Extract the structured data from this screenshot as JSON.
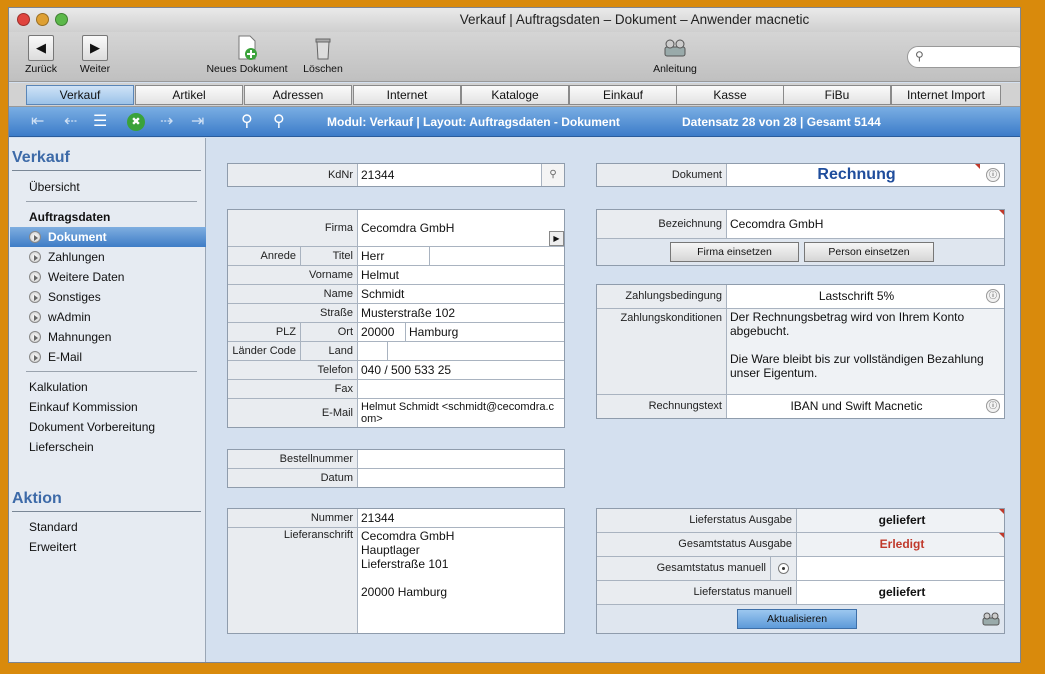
{
  "window": {
    "title": "Verkauf | Auftragsdaten – Dokument – Anwender macnetic"
  },
  "toolbar": {
    "back": "Zurück",
    "forward": "Weiter",
    "new_document": "Neues Dokument",
    "delete": "Löschen",
    "guide": "Anleitung",
    "search_placeholder": ""
  },
  "tabs": [
    "Verkauf",
    "Artikel",
    "Adressen",
    "Internet",
    "Kataloge",
    "Einkauf",
    "Kasse",
    "FiBu",
    "Internet Import"
  ],
  "navbar": {
    "modul": "Modul: Verkauf | Layout: Auftragsdaten - Dokument",
    "datensatz": "Datensatz 28 von 28 | Gesamt 5144"
  },
  "sidebar": {
    "section1": "Verkauf",
    "overview": "Übersicht",
    "auftragsdaten": "Auftragsdaten",
    "items": [
      "Dokument",
      "Zahlungen",
      "Weitere Daten",
      "Sonstiges",
      "wAdmin",
      "Mahnungen",
      "E-Mail"
    ],
    "items2": [
      "Kalkulation",
      "Einkauf Kommission",
      "Dokument Vorbereitung",
      "Lieferschein"
    ],
    "section2": "Aktion",
    "actions": [
      "Standard",
      "Erweitert"
    ]
  },
  "customer": {
    "kdnr_label": "KdNr",
    "kdnr": "21344"
  },
  "address": {
    "firma_label": "Firma",
    "firma": "Cecomdra GmbH",
    "anrede_label": "Anrede",
    "titel_label": "Titel",
    "titel": "Herr",
    "vorname_label": "Vorname",
    "vorname": "Helmut",
    "name_label": "Name",
    "name": "Schmidt",
    "strasse_label": "Straße",
    "strasse": "Musterstraße 102",
    "plz_label": "PLZ",
    "ort_label": "Ort",
    "plz": "20000",
    "ort": "Hamburg",
    "laendercode_label": "Länder Code",
    "land_label": "Land",
    "telefon_label": "Telefon",
    "telefon": "040 / 500 533 25",
    "fax_label": "Fax",
    "email_label": "E-Mail",
    "email": "Helmut Schmidt <schmidt@cecomdra.com>"
  },
  "order": {
    "bestell_label": "Bestellnummer",
    "datum_label": "Datum"
  },
  "delivery": {
    "nummer_label": "Nummer",
    "nummer": "21344",
    "anschrift_label": "Lieferanschrift",
    "anschrift": [
      "Cecomdra GmbH",
      "Hauptlager",
      "Lieferstraße 101",
      "",
      "20000 Hamburg"
    ]
  },
  "document": {
    "label": "Dokument",
    "value": "Rechnung"
  },
  "bezeichnung": {
    "label": "Bezeichnung",
    "value": "Cecomdra GmbH",
    "firma_btn": "Firma einsetzen",
    "person_btn": "Person einsetzen"
  },
  "payment": {
    "bedingung_label": "Zahlungsbedingung",
    "bedingung": "Lastschrift 5%",
    "konditionen_label": "Zahlungskonditionen",
    "konditionen_1": "Der Rechnungsbetrag wird von Ihrem Konto abgebucht.",
    "konditionen_2": "Die Ware bleibt bis zur vollständigen Bezahlung unser Eigentum.",
    "text_label": "Rechnungstext",
    "text": "IBAN und Swift Macnetic"
  },
  "status": {
    "liefer_label": "Lieferstatus Ausgabe",
    "liefer": "geliefert",
    "gesamt_label": "Gesamtstatus Ausgabe",
    "gesamt": "Erledigt",
    "gesamt_manuell_label": "Gesamtstatus manuell",
    "liefer_manuell_label": "Lieferstatus manuell",
    "liefer_manuell": "geliefert",
    "update_btn": "Aktualisieren"
  },
  "colors": {
    "accent": "#3e7cc6",
    "erledigt": "#c0392b",
    "rechnung": "#1f4d9c"
  }
}
